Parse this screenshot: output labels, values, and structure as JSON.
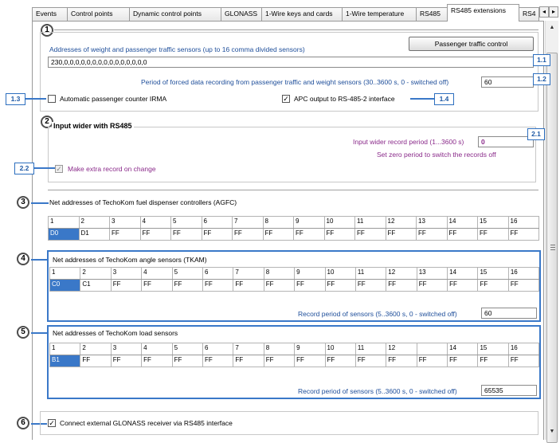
{
  "tabs": [
    "Events",
    "Control points",
    "Dynamic control points",
    "GLONASS",
    "1-Wire keys and cards",
    "1-Wire temperature",
    "RS485",
    "RS485 extensions",
    "RS4"
  ],
  "active_tab": "RS485 extensions",
  "tab_scroll": {
    "left": "◂",
    "right": "▸"
  },
  "callouts": {
    "c1": "1",
    "c2": "2",
    "c3": "3",
    "c4": "4",
    "c5": "5",
    "c6": "6",
    "b11": "1.1",
    "b12": "1.2",
    "b13": "1.3",
    "b14": "1.4",
    "b21": "2.1",
    "b22": "2.2"
  },
  "section1": {
    "passenger_button": "Passenger traffic control",
    "addresses_label": "Addresses of weight and passenger traffic sensors (up to 16 comma divided sensors)",
    "addresses_value": "230,0,0,0,0,0,0,0,0,0,0,0,0,0,0,0",
    "period_label": "Period of forced data recording from passenger traffic and weight sensors (30..3600 s, 0 - switched off)",
    "period_value": "60",
    "irma_label": "Automatic passenger counter IRMA",
    "irma_checked": false,
    "apc_label": "APC output to RS-485-2 interface",
    "apc_checked": true
  },
  "section2": {
    "title": "Input wider with RS485",
    "record_period_label": "Input wider record period (1...3600 s)",
    "record_period_value": "0",
    "zero_hint": "Set zero period to switch the records off",
    "extra_record_label": "Make extra record on change",
    "extra_record_checked": true
  },
  "section3": {
    "title": "Net addresses of TechoKom fuel dispenser controllers (AGFC)",
    "headers": [
      "1",
      "2",
      "3",
      "4",
      "5",
      "6",
      "7",
      "8",
      "9",
      "10",
      "11",
      "12",
      "13",
      "14",
      "15",
      "16"
    ],
    "values": [
      "D0",
      "D1",
      "FF",
      "FF",
      "FF",
      "FF",
      "FF",
      "FF",
      "FF",
      "FF",
      "FF",
      "FF",
      "FF",
      "FF",
      "FF",
      "FF"
    ]
  },
  "section4": {
    "title": "Net addresses of TechoKom angle sensors (TKAM)",
    "headers": [
      "1",
      "2",
      "3",
      "4",
      "5",
      "6",
      "7",
      "8",
      "9",
      "10",
      "11",
      "12",
      "13",
      "14",
      "15",
      "16"
    ],
    "values": [
      "C0",
      "C1",
      "FF",
      "FF",
      "FF",
      "FF",
      "FF",
      "FF",
      "FF",
      "FF",
      "FF",
      "FF",
      "FF",
      "FF",
      "FF",
      "FF"
    ],
    "period_label": "Record period of sensors (5..3600 s, 0 - switched off)",
    "period_value": "60"
  },
  "section5": {
    "title": "Net addresses of TechoKom load sensors",
    "headers": [
      "1",
      "2",
      "3",
      "4",
      "5",
      "6",
      "7",
      "8",
      "9",
      "10",
      "11",
      "12",
      "",
      "14",
      "15",
      "16"
    ],
    "values": [
      "B1",
      "FF",
      "FF",
      "FF",
      "FF",
      "FF",
      "FF",
      "FF",
      "FF",
      "FF",
      "FF",
      "FF",
      "FF",
      "FF",
      "FF",
      "FF"
    ],
    "period_label": "Record period of sensors (5..3600 s, 0 - switched off)",
    "period_value": "65535"
  },
  "section6": {
    "glonass_label": "Connect external GLONASS receiver via RS485 interface",
    "glonass_checked": true
  },
  "colors": {
    "accent": "#3a78c8",
    "purple_text": "#8a2a8a",
    "badge_text": "#1f5aa6"
  }
}
